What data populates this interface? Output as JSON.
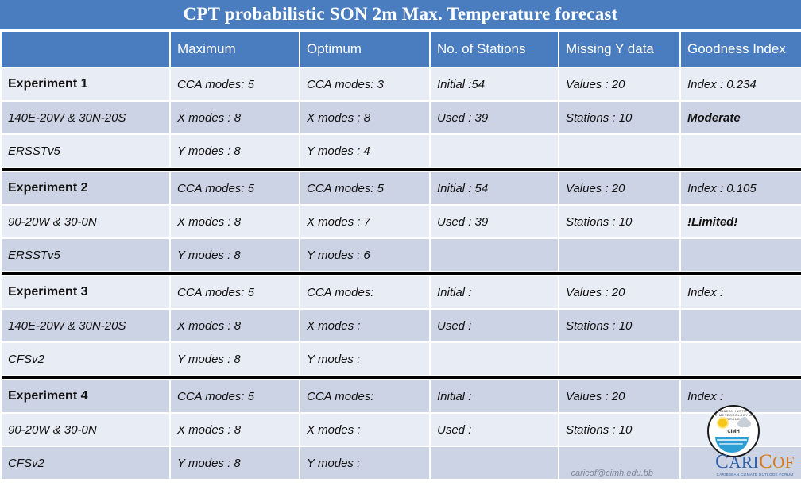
{
  "title": "CPT probabilistic SON 2m Max. Temperature forecast",
  "table": {
    "columns": [
      "",
      "Maximum",
      "Optimum",
      "No. of Stations",
      "Missing Y data",
      "Goodness Index"
    ],
    "blocks": [
      {
        "name": "Experiment 1",
        "rows": [
          [
            "Experiment 1",
            "CCA modes: 5",
            "CCA modes: 3",
            "Initial :54",
            "Values : 20",
            "Index : 0.234"
          ],
          [
            "140E-20W & 30N-20S",
            "X modes : 8",
            "X modes : 8",
            "Used : 39",
            "Stations : 10",
            "Moderate"
          ],
          [
            "ERSSTv5",
            "Y modes : 8",
            "Y modes : 4",
            "",
            "",
            ""
          ]
        ]
      },
      {
        "name": "Experiment 2",
        "rows": [
          [
            "Experiment 2",
            "CCA modes: 5",
            "CCA modes: 5",
            "Initial : 54",
            "Values : 20",
            "Index : 0.105"
          ],
          [
            "90-20W & 30-0N",
            "X modes : 8",
            "X modes : 7",
            "Used : 39",
            "Stations : 10",
            "!Limited!"
          ],
          [
            "ERSSTv5",
            "Y modes : 8",
            "Y modes : 6",
            "",
            "",
            ""
          ]
        ]
      },
      {
        "name": "Experiment 3",
        "rows": [
          [
            "Experiment 3",
            "CCA modes: 5",
            "CCA modes:",
            "Initial :",
            "Values : 20",
            "Index :"
          ],
          [
            "140E-20W & 30N-20S",
            "X modes : 8",
            "X modes :",
            "Used :",
            "Stations : 10",
            ""
          ],
          [
            "CFSv2",
            "Y modes : 8",
            "Y modes :",
            "",
            "",
            ""
          ]
        ]
      },
      {
        "name": "Experiment 4",
        "rows": [
          [
            "Experiment 4",
            "CCA modes: 5",
            "CCA modes:",
            "Initial :",
            "Values : 20",
            "Index :"
          ],
          [
            "90-20W & 30-0N",
            "X modes : 8",
            "X modes :",
            "Used :",
            "Stations : 10",
            ""
          ],
          [
            "CFSv2",
            "Y modes : 8",
            "Y modes :",
            "",
            "",
            ""
          ]
        ]
      }
    ]
  },
  "branding": {
    "email": "caricof@cimh.edu.bb",
    "seal_ring_text": "CARIBBEAN INSTITUTE FOR METEOROLOGY AND HYDROLOGY",
    "seal_label": "CIMH",
    "caricof_c": "C",
    "caricof_ari": "ARI",
    "caricof_c2": "C",
    "caricof_of": "OF",
    "caricof_tagline": "CARIBBEAN CLIMATE OUTLOOK FORUM"
  },
  "colors": {
    "banner": "#4a7dbf",
    "row_light": "#e8ecf4",
    "row_dark": "#ccd3e4",
    "separator": "#000000",
    "caricof_blue": "#2f5fa8",
    "caricof_orange": "#d97b1a"
  }
}
